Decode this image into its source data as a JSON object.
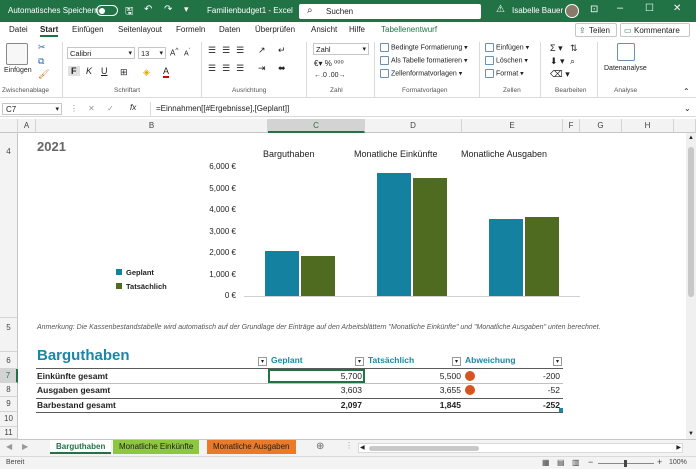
{
  "titlebar": {
    "autosave_label": "Automatisches Speichern",
    "toggle_state": "Aus",
    "filename": "Familienbudget1",
    "app": "Excel",
    "search_placeholder": "Suchen",
    "user": "Isabelle Bauer"
  },
  "tabs": [
    "Datei",
    "Start",
    "Einfügen",
    "Seitenlayout",
    "Formeln",
    "Daten",
    "Überprüfen",
    "Ansicht",
    "Hilfe",
    "Tabellenentwurf"
  ],
  "active_tab": "Start",
  "share": {
    "share_label": "Teilen",
    "comments_label": "Kommentare"
  },
  "ribbon": {
    "paste_label": "Einfügen",
    "font_name": "Calibri",
    "font_size": "13",
    "number_format": "Zahl",
    "cond_format": "Bedingte Formatierung",
    "as_table": "Als Tabelle formatieren",
    "cell_styles": "Zellenformatvorlagen",
    "insert": "Einfügen",
    "delete": "Löschen",
    "format": "Format",
    "data_analysis": "Datenanalyse",
    "groups": {
      "clipboard": "Zwischenablage",
      "font": "Schriftart",
      "alignment": "Ausrichtung",
      "number": "Zahl",
      "styles": "Formatvorlagen",
      "cells": "Zellen",
      "editing": "Bearbeiten",
      "analysis": "Analyse"
    }
  },
  "formula_bar": {
    "name_box": "C7",
    "fx": "fx",
    "formula": "=Einnahmen[[#Ergebnisse],[Geplant]]"
  },
  "columns": [
    "A",
    "B",
    "C",
    "D",
    "E",
    "F",
    "G",
    "H"
  ],
  "rows": [
    "4",
    "5",
    "6",
    "7",
    "8",
    "9",
    "10",
    "11"
  ],
  "sheet": {
    "year": "2021",
    "note": "Anmerkung: Die Kassenbestandstabelle wird automatisch auf der Grundlage der Einträge auf den Arbeitsblättern \"Monatliche Einkünfte\" und \"Monatliche Ausgaben\" unten berechnet.",
    "table_title": "Barguthaben",
    "headers": [
      "Geplant",
      "Tatsächlich",
      "Abweichung"
    ],
    "rows": [
      {
        "label": "Einkünfte gesamt",
        "planned": "5,700",
        "actual": "5,500",
        "diff": "-200"
      },
      {
        "label": "Ausgaben gesamt",
        "planned": "3,603",
        "actual": "3,655",
        "diff": "-52"
      },
      {
        "label": "Barbestand gesamt",
        "planned": "2,097",
        "actual": "1,845",
        "diff": "-252"
      }
    ]
  },
  "chart_data": {
    "type": "bar",
    "categories": [
      "Barguthaben",
      "Monatliche Einkünfte",
      "Monatliche Ausgaben"
    ],
    "series": [
      {
        "name": "Geplant",
        "values": [
          2097,
          5700,
          3603
        ],
        "color": "#1581a0"
      },
      {
        "name": "Tatsächlich",
        "values": [
          1845,
          5500,
          3655
        ],
        "color": "#4e6b1f"
      }
    ],
    "ylim": [
      0,
      6000
    ],
    "yticks": [
      "0 €",
      "1,000 €",
      "2,000 €",
      "3,000 €",
      "4,000 €",
      "5,000 €",
      "6,000 €"
    ],
    "legend": "left"
  },
  "sheet_tabs": [
    {
      "label": "Barguthaben",
      "color": "#217346"
    },
    {
      "label": "Monatliche Einkünfte",
      "color": "#8dc63f"
    },
    {
      "label": "Monatliche Ausgaben",
      "color": "#ea7a27"
    }
  ],
  "status": {
    "ready": "Bereit",
    "zoom": "100%"
  },
  "colors": {
    "accent": "#217346",
    "title_teal": "#1b87a7",
    "warning": "#d9531e"
  }
}
